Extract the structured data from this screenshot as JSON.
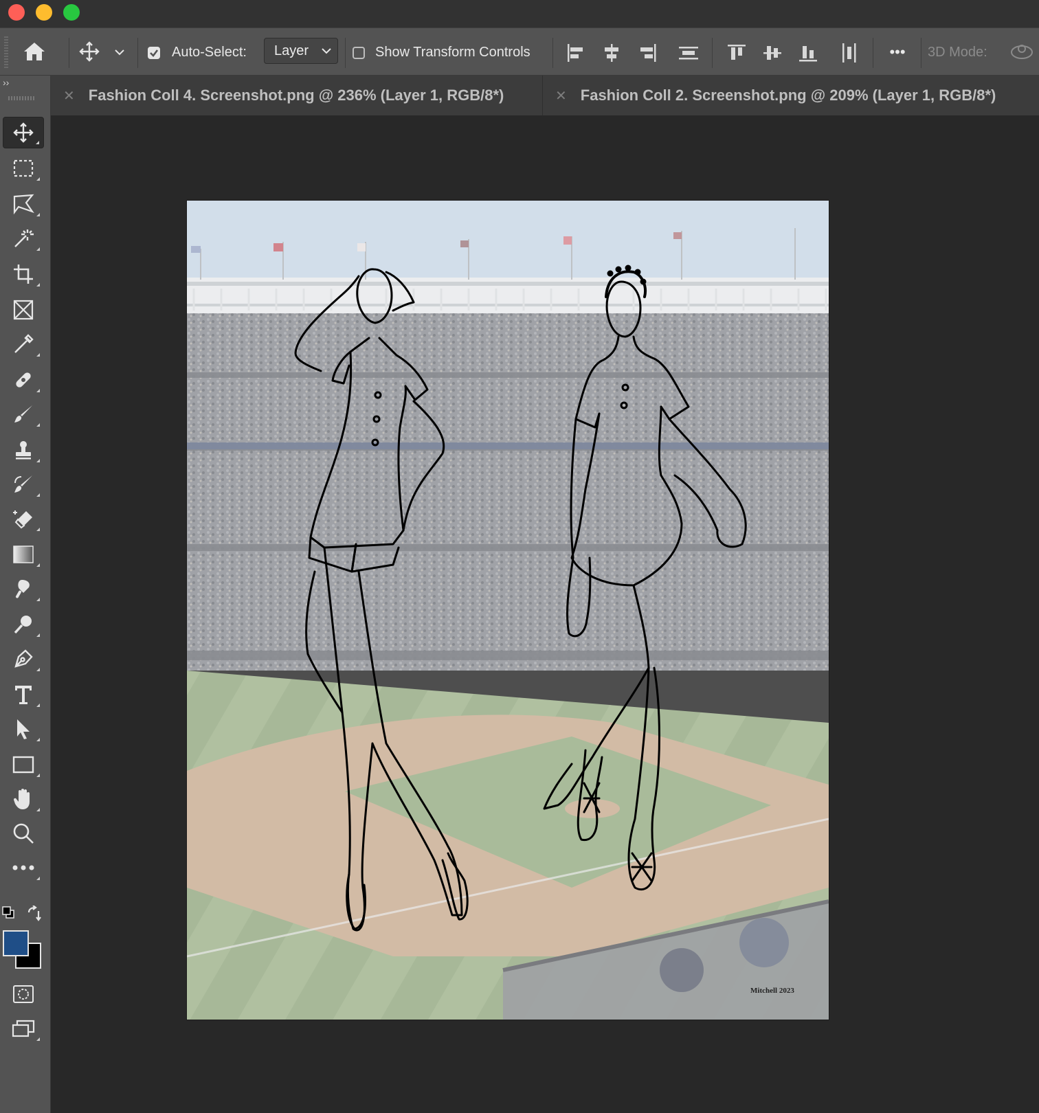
{
  "window": {
    "controls": [
      "close",
      "minimize",
      "maximize"
    ]
  },
  "options_bar": {
    "auto_select_label": "Auto-Select:",
    "auto_select_checked": true,
    "layer_select_value": "Layer",
    "show_transform_label": "Show Transform Controls",
    "show_transform_checked": false,
    "more_label": "•••",
    "mode_3d_label": "3D Mode:"
  },
  "tabs": [
    {
      "label": "Fashion Coll 4. Screenshot.png @ 236% (Layer 1, RGB/8*)",
      "active": false
    },
    {
      "label": "Fashion Coll 2.  Screenshot.png @ 209% (Layer 1, RGB/8*)",
      "active": false
    }
  ],
  "toolbar": {
    "collapse_label": "››",
    "tools": [
      {
        "name": "move-tool",
        "icon": "move-icon",
        "active": true
      },
      {
        "name": "rectangular-marquee-tool",
        "icon": "marquee-icon"
      },
      {
        "name": "lasso-tool",
        "icon": "lasso-icon"
      },
      {
        "name": "magic-wand-tool",
        "icon": "magic-wand-icon"
      },
      {
        "name": "crop-tool",
        "icon": "crop-icon"
      },
      {
        "name": "frame-tool",
        "icon": "frame-icon"
      },
      {
        "name": "eyedropper-tool",
        "icon": "eyedropper-icon"
      },
      {
        "name": "healing-brush-tool",
        "icon": "bandage-icon"
      },
      {
        "name": "brush-tool",
        "icon": "brush-icon"
      },
      {
        "name": "clone-stamp-tool",
        "icon": "stamp-icon"
      },
      {
        "name": "history-brush-tool",
        "icon": "history-brush-icon"
      },
      {
        "name": "eraser-tool",
        "icon": "eraser-icon"
      },
      {
        "name": "gradient-tool",
        "icon": "gradient-icon"
      },
      {
        "name": "smudge-tool",
        "icon": "smudge-icon"
      },
      {
        "name": "dodge-tool",
        "icon": "dodge-icon"
      },
      {
        "name": "pen-tool",
        "icon": "pen-icon"
      },
      {
        "name": "type-tool",
        "icon": "type-icon"
      },
      {
        "name": "path-selection-tool",
        "icon": "arrow-icon"
      },
      {
        "name": "rectangle-tool",
        "icon": "rectangle-icon"
      },
      {
        "name": "hand-tool",
        "icon": "hand-icon"
      },
      {
        "name": "zoom-tool",
        "icon": "zoom-icon"
      },
      {
        "name": "edit-toolbar",
        "icon": "more-icon"
      }
    ],
    "foreground_color": "#1f4e87",
    "background_color": "#000000"
  },
  "document": {
    "signature": "Mitchell 2023",
    "sky_color": "#c9d7e6",
    "stands_color": "#8d8f93",
    "grass_color": "#9db08a",
    "dirt_color": "#c8ad92"
  }
}
